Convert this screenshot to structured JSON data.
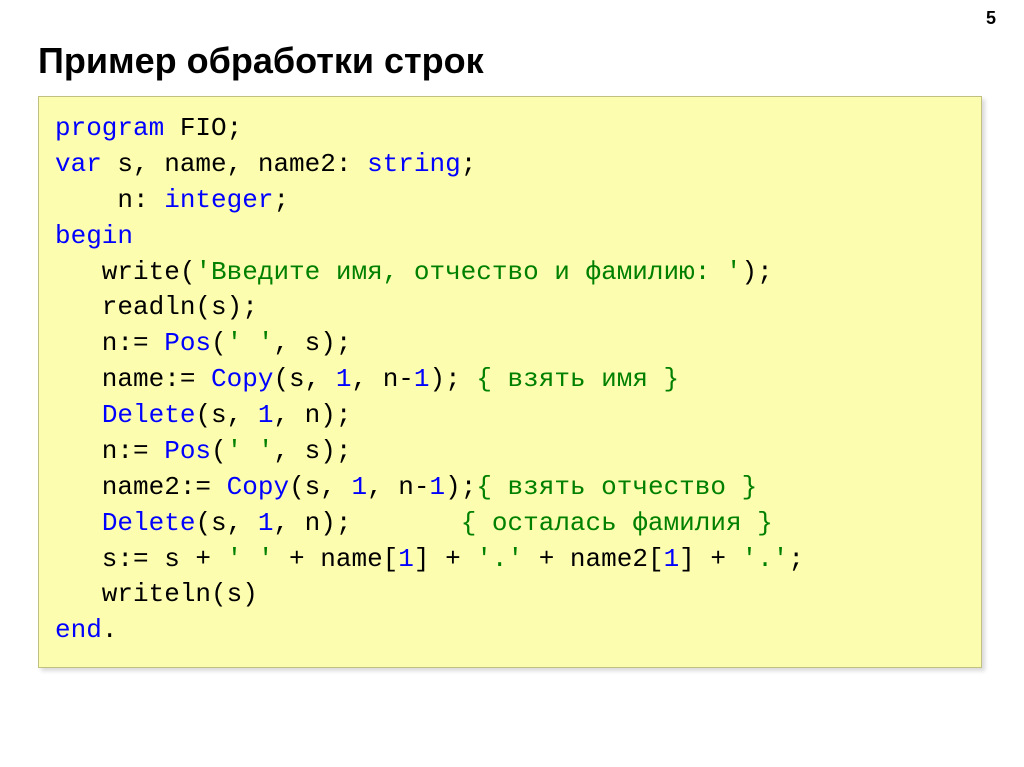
{
  "page_number": "5",
  "title": "Пример обработки строк",
  "code": {
    "l01_a": "program",
    "l01_b": " FIO;",
    "l02_a": "var",
    "l02_b": " s, name, name2: ",
    "l02_c": "string",
    "l02_d": ";",
    "l03_a": "    n: ",
    "l03_b": "integer",
    "l03_c": ";",
    "l04_a": "begin",
    "l05_a": "   write(",
    "l05_b": "'Введите имя, отчество и фамилию: '",
    "l05_c": ");",
    "l06_a": "   readln(s);",
    "l07_a": "   n:= ",
    "l07_b": "Pos",
    "l07_c": "(",
    "l07_d": "' '",
    "l07_e": ", s);",
    "l08_a": "   name:= ",
    "l08_b": "Copy",
    "l08_c": "(s, ",
    "l08_d": "1",
    "l08_e": ", n-",
    "l08_f": "1",
    "l08_g": "); ",
    "l08_h": "{ взять имя }",
    "l09_a": "   ",
    "l09_b": "Delete",
    "l09_c": "(s, ",
    "l09_d": "1",
    "l09_e": ", n);",
    "l10_a": "   n:= ",
    "l10_b": "Pos",
    "l10_c": "(",
    "l10_d": "' '",
    "l10_e": ", s);",
    "l11_a": "   name2:= ",
    "l11_b": "Copy",
    "l11_c": "(s, ",
    "l11_d": "1",
    "l11_e": ", n-",
    "l11_f": "1",
    "l11_g": ");",
    "l11_h": "{ взять отчество }",
    "l12_a": "   ",
    "l12_b": "Delete",
    "l12_c": "(s, ",
    "l12_d": "1",
    "l12_e": ", n);       ",
    "l12_f": "{ осталась фамилия }",
    "l13_a": "   s:= s + ",
    "l13_b": "' '",
    "l13_c": " + name[",
    "l13_d": "1",
    "l13_e": "] + ",
    "l13_f": "'.'",
    "l13_g": " + name2[",
    "l13_h": "1",
    "l13_i": "] + ",
    "l13_j": "'.'",
    "l13_k": ";",
    "l14_a": "   writeln(s)",
    "l15_a": "end",
    "l15_b": "."
  }
}
